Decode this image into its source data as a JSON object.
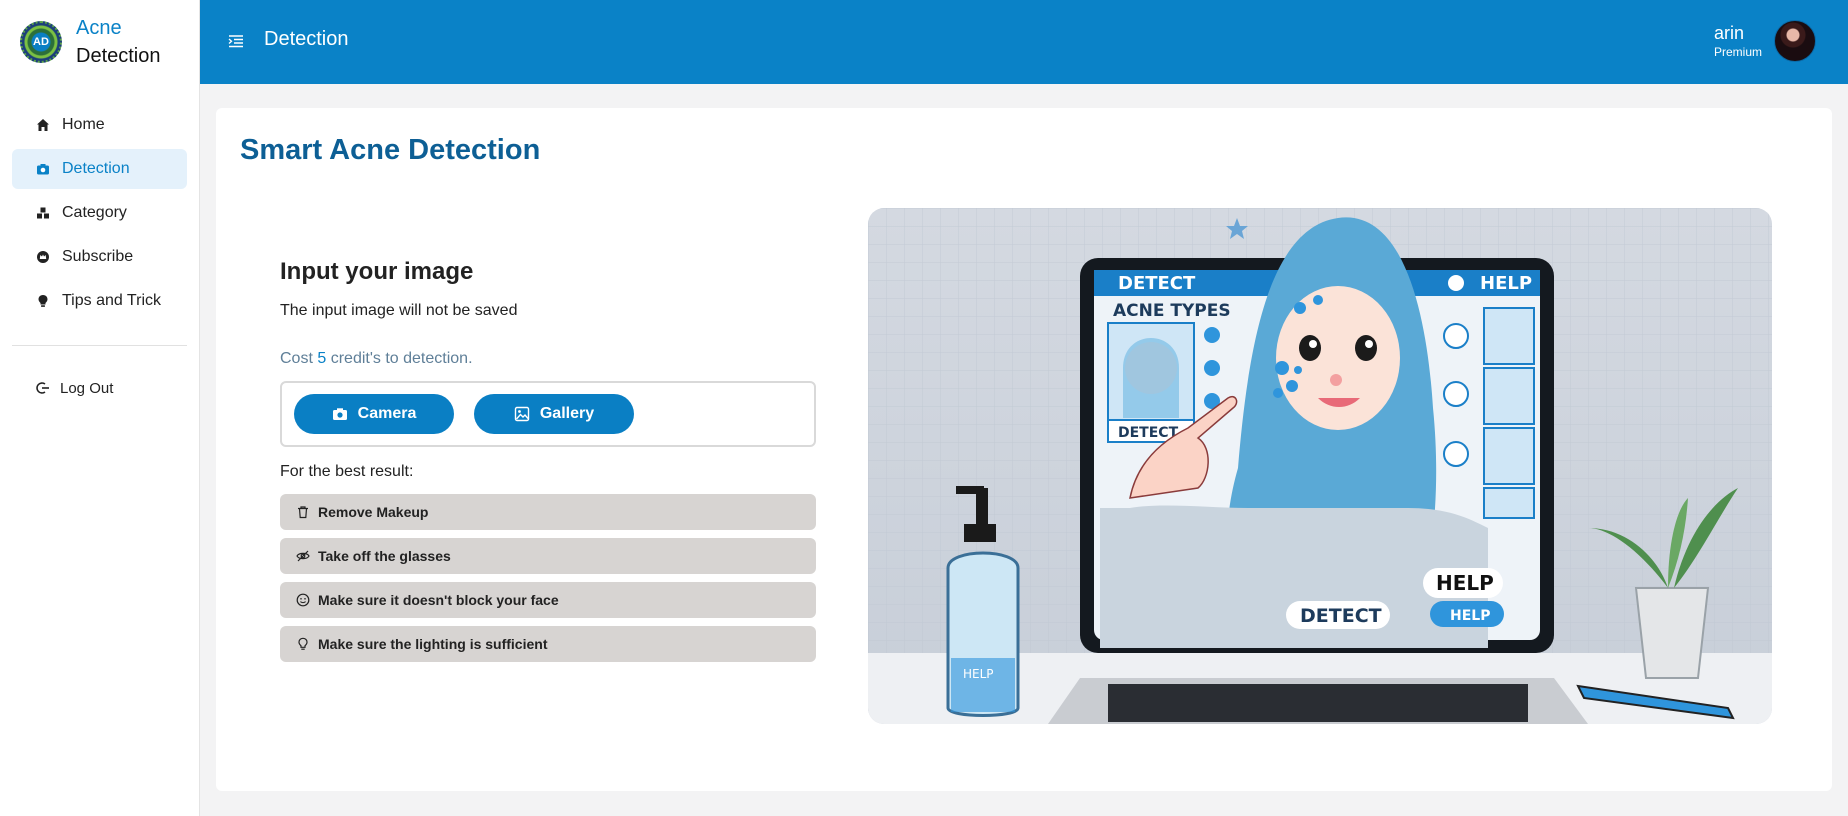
{
  "brand": {
    "logo_text": "AD",
    "line1": "Acne",
    "line2": "Detection"
  },
  "sidebar": {
    "items": [
      {
        "label": "Home",
        "icon": "home-icon",
        "active": false
      },
      {
        "label": "Detection",
        "icon": "camera-icon",
        "active": true
      },
      {
        "label": "Category",
        "icon": "category-icon",
        "active": false
      },
      {
        "label": "Subscribe",
        "icon": "crown-icon",
        "active": false
      },
      {
        "label": "Tips and Trick",
        "icon": "lightbulb-icon",
        "active": false
      }
    ],
    "logout_label": "Log Out"
  },
  "header": {
    "title": "Detection",
    "user_name": "arin",
    "user_plan": "Premium"
  },
  "main": {
    "title": "Smart Acne Detection",
    "input_heading": "Input your image",
    "input_note": "The input image will not be saved",
    "cost_prefix": "Cost",
    "cost_value": "5",
    "cost_suffix": "credit's to detection.",
    "camera_label": "Camera",
    "gallery_label": "Gallery",
    "best_result_label": "For the best result:",
    "tips": [
      {
        "label": "Remove Makeup",
        "icon": "trash-icon"
      },
      {
        "label": "Take off the glasses",
        "icon": "eye-off-icon"
      },
      {
        "label": "Make sure it doesn't block your face",
        "icon": "smile-icon"
      },
      {
        "label": "Make sure the lighting is sufficient",
        "icon": "lightbulb-icon"
      }
    ]
  },
  "illustration": {
    "detect_tab": "DETECT",
    "help_tab": "HELP",
    "acne_types": "ACNE TYPES",
    "detect_small": "DETECT",
    "help_bubble": "HELP",
    "detect_bubble": "DETECT",
    "help_button": "HELP",
    "bottle_label": "HELP"
  },
  "colors": {
    "primary": "#0a82c7",
    "title": "#0d5f95",
    "tip_bg": "#d7d4d2",
    "active_bg": "#e4f1fb"
  }
}
